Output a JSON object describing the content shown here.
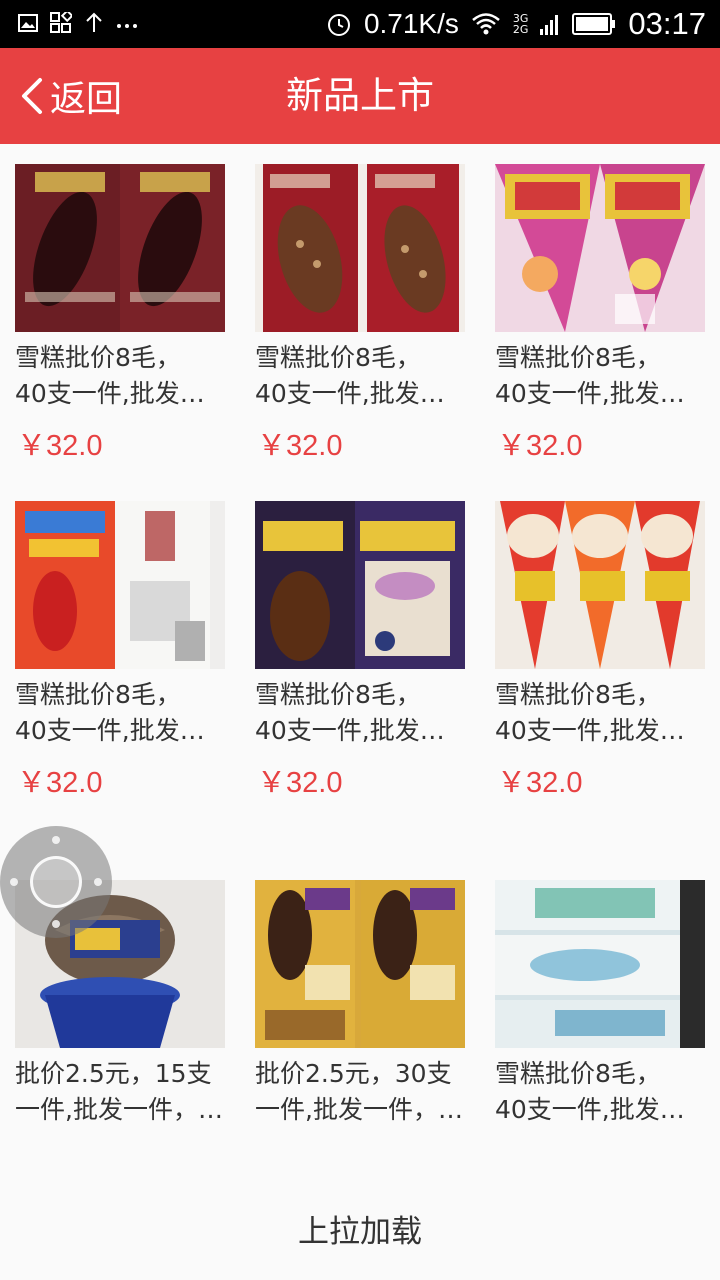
{
  "status_bar": {
    "network_speed": "0.71K/s",
    "network_type_top": "3G",
    "network_type_bottom": "2G",
    "time": "03:17",
    "icons": [
      "image-icon",
      "app-grid-icon",
      "upload-arrow-icon",
      "more-dots-icon",
      "alarm-icon",
      "wifi-icon",
      "signal-icon",
      "battery-icon"
    ]
  },
  "nav": {
    "back_label": "返回",
    "title": "新品上市",
    "color": "#e74142"
  },
  "products": [
    {
      "name_line1": "雪糕批价8毛，",
      "name_line2": "40支一件,批发一…",
      "price": "￥32.0",
      "image": "chocolate-crispy-ice-cream-bars"
    },
    {
      "name_line1": "雪糕批价8毛，",
      "name_line2": "40支一件,批发一…",
      "price": "￥32.0",
      "image": "chocolate-nut-ice-cream-bars"
    },
    {
      "name_line1": "雪糕批价8毛，",
      "name_line2": "40支一件,批发一…",
      "price": "￥32.0",
      "image": "pink-cone-ice-cream"
    },
    {
      "name_line1": "雪糕批价8毛，",
      "name_line2": "40支一件,批发一…",
      "price": "￥32.0",
      "image": "hawthorn-popsicle-packs"
    },
    {
      "name_line1": "雪糕批价8毛，",
      "name_line2": "40支一件,批发一…",
      "price": "￥32.0",
      "image": "chocolate-blueberry-bars"
    },
    {
      "name_line1": "雪糕批价8毛，",
      "name_line2": "40支一件,批发一…",
      "price": "￥32.0",
      "image": "fruit-cone-ice-cream"
    },
    {
      "name_line1": "批价2.5元，15支",
      "name_line2": "一件,批发一件，…",
      "price": "",
      "image": "blue-cup-soft-serve"
    },
    {
      "name_line1": "批价2.5元，30支",
      "name_line2": "一件,批发一件，…",
      "price": "",
      "image": "gold-chocolate-bars"
    },
    {
      "name_line1": "雪糕批价8毛，",
      "name_line2": "40支一件,批发一…",
      "price": "",
      "image": "milk-brick-ice-cream"
    }
  ],
  "load_more": "上拉加载",
  "accent_price_color": "#e74142"
}
